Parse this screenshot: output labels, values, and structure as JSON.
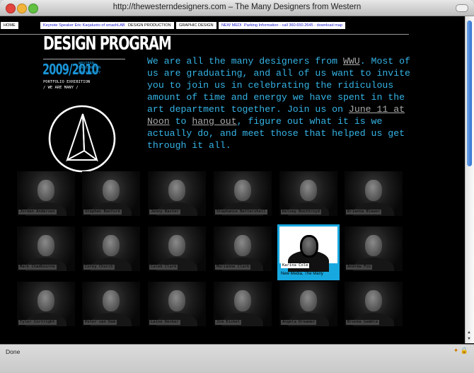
{
  "window": {
    "title": "http://thewesterndesigners.com – The Many Designers from Western",
    "status": "Done"
  },
  "nav": [
    {
      "label": "HOME",
      "link": false
    },
    {
      "label": "Keynote Speaker Eric Karjaluoto of smashLAB",
      "link": true
    },
    {
      "label": "DESIGN PRODUCTION",
      "link": false
    },
    {
      "label": "GRAPHIC DESIGN",
      "link": false
    },
    {
      "label": "NEW MEDIA",
      "link": true
    },
    {
      "label": "Parking Information - call 360.650.2645 - download map",
      "link": true
    }
  ],
  "logo": {
    "title": "DESIGN PROGRAM",
    "year": "2009/2010",
    "university": [
      "WESTERN",
      "WASHINGTON",
      "UNIVERSITY"
    ],
    "exhibition": [
      "PORTFOLIO EXHIBITION",
      "/ WE ARE MANY /"
    ]
  },
  "intro": {
    "p1": "We are all the many designers from ",
    "wwu": "WWU",
    "p2": ". Most of us are graduating, and all of us want to invite you to join us in celebrating the ridiculous amount of time and energy we have spent in the art department together. Join us on ",
    "date": "June 11 at Noon",
    "p3": " to ",
    "hang": "hang out",
    "p4": ", figure out what it is we actually do, and meet those that helped us get through it all."
  },
  "designers": [
    "Jordan Andersen",
    "Stephen Banford",
    "Jenny Baxter",
    "Stephanie Battershell",
    "Kelsey Boothroyd",
    "Brianna Blewer",
    "Mark Chadbourne",
    "Corey Church",
    "Caleb Clark",
    "Marianne Clark",
    "Karina Cole",
    "Andrew Fox",
    "Tyler Cortright",
    "Peter van Dam",
    "Laine Decker",
    "Jim Eickel",
    "Angela Dreamer",
    "Brooke Gamble"
  ],
  "active_designer": {
    "name": "Karina Cole",
    "role": "New Media, The Many"
  },
  "colors": {
    "accent": "#18a8e0",
    "intro_text": "#35b4e6",
    "background": "#000000"
  }
}
